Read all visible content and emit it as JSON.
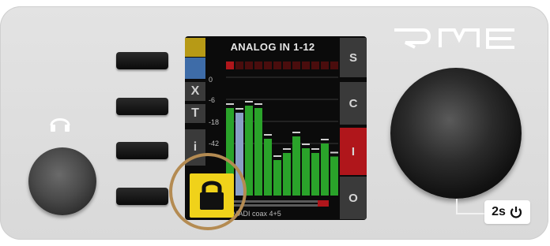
{
  "device": {
    "brand": "RME"
  },
  "display": {
    "title": "ANALOG IN 1-12",
    "left_tabs": [
      "X",
      "T",
      "i"
    ],
    "scale_labels": [
      "0",
      "-6",
      "-18",
      "-42"
    ],
    "right_buttons": [
      "S",
      "C",
      "I",
      "O"
    ],
    "madi_label": "MADI coax 4+5",
    "channel_levels": [
      0.74,
      0.7,
      0.76,
      0.74,
      0.48,
      0.3,
      0.36,
      0.5,
      0.4,
      0.36,
      0.44,
      0.33
    ],
    "channel_colors": [
      "#2aa32a",
      "#8aa0c6",
      "#2aa32a",
      "#2aa32a",
      "#2aa32a",
      "#2aa32a",
      "#2aa32a",
      "#2aa32a",
      "#2aa32a",
      "#2aa32a",
      "#2aa32a",
      "#2aa32a"
    ],
    "active_right_button": "I"
  },
  "lock": {
    "name": "lock-icon"
  },
  "knob_hint": {
    "label": "2s"
  },
  "colors": {
    "accent_yellow": "#f0d21a",
    "ring": "#b48b52",
    "red": "#b0161b",
    "meter_green": "#2aa32a"
  }
}
